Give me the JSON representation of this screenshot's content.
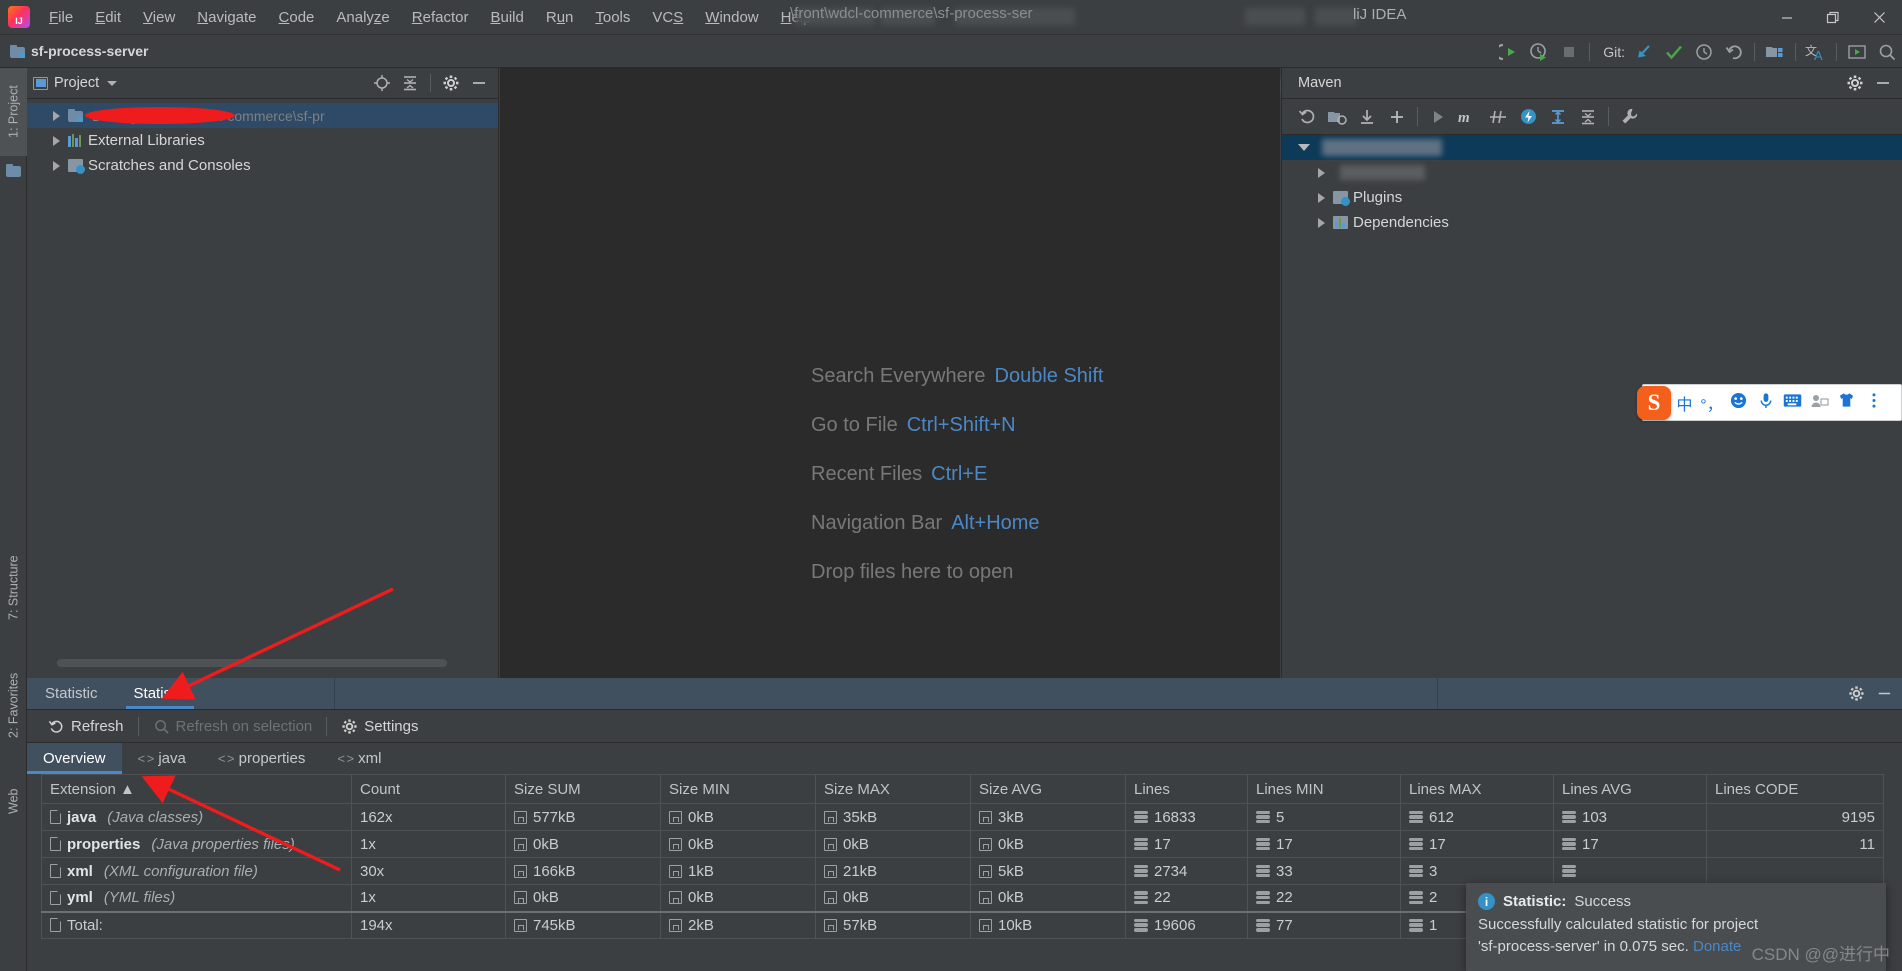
{
  "window": {
    "app_name": "liJ IDEA",
    "title_path_visible": "\\front\\wdcl-commerce\\sf-process-ser",
    "minimize": "─",
    "maximize": "❐",
    "close": "✕"
  },
  "menubar": {
    "items": [
      {
        "label": "File"
      },
      {
        "label": "Edit"
      },
      {
        "label": "View"
      },
      {
        "label": "Navigate"
      },
      {
        "label": "Code"
      },
      {
        "label": "Analyze"
      },
      {
        "label": "Refactor"
      },
      {
        "label": "Build"
      },
      {
        "label": "Run"
      },
      {
        "label": "Tools"
      },
      {
        "label": "VCS"
      },
      {
        "label": "Window"
      },
      {
        "label": "Help"
      }
    ]
  },
  "toolbar": {
    "project_name": "sf-process-server",
    "git_label": "Git:"
  },
  "stripe": {
    "left_top": "1: Project",
    "structure": "7: Structure",
    "favorites": "2: Favorites",
    "web": "Web"
  },
  "project_panel": {
    "title": "Project",
    "tree": [
      {
        "label": "",
        "path": "D:\\fenglian\\front\\wdcl-commerce\\sf-pr",
        "icon": "module-icon",
        "selected": true,
        "redacted": true
      },
      {
        "label": "External Libraries",
        "path": "",
        "icon": "libraries-icon",
        "selected": false,
        "redacted": false
      },
      {
        "label": "Scratches and Consoles",
        "path": "",
        "icon": "scratches-icon",
        "selected": false,
        "redacted": false
      }
    ]
  },
  "editor": {
    "hints": [
      {
        "action": "Search Everywhere",
        "shortcut": "Double Shift"
      },
      {
        "action": "Go to File",
        "shortcut": "Ctrl+Shift+N"
      },
      {
        "action": "Recent Files",
        "shortcut": "Ctrl+E"
      },
      {
        "action": "Navigation Bar",
        "shortcut": "Alt+Home"
      },
      {
        "action": "Drop files here to open",
        "shortcut": ""
      }
    ]
  },
  "maven_panel": {
    "title": "Maven",
    "tree": [
      {
        "label": "",
        "blurred": true,
        "level": 0,
        "expanded": true,
        "selected": true
      },
      {
        "label": "",
        "blurred": true,
        "level": 1,
        "expanded": false,
        "selected": false
      },
      {
        "label": "Plugins",
        "blurred": false,
        "level": 1,
        "expanded": false,
        "selected": false
      },
      {
        "label": "Dependencies",
        "blurred": false,
        "level": 1,
        "expanded": false,
        "selected": false
      }
    ]
  },
  "bottom_window": {
    "tabs": [
      {
        "label": "Statistic",
        "active": false
      },
      {
        "label": "Statistic",
        "active": true
      }
    ],
    "actions": [
      {
        "label": "Refresh",
        "icon": "refresh-icon",
        "disabled": false
      },
      {
        "label": "Refresh on selection",
        "icon": "search-icon",
        "disabled": true
      },
      {
        "label": "Settings",
        "icon": "gear-icon",
        "disabled": false
      }
    ],
    "sub_tabs": [
      {
        "label": "Overview",
        "icon": "",
        "active": true
      },
      {
        "label": "java",
        "icon": "angle-brackets",
        "active": false
      },
      {
        "label": "properties",
        "icon": "angle-brackets",
        "active": false
      },
      {
        "label": "xml",
        "icon": "angle-brackets",
        "active": false
      }
    ]
  },
  "stat_table": {
    "columns": [
      "Extension ▲",
      "Count",
      "Size SUM",
      "Size MIN",
      "Size MAX",
      "Size AVG",
      "Lines",
      "Lines MIN",
      "Lines MAX",
      "Lines AVG",
      "Lines CODE"
    ],
    "rows": [
      {
        "extension": "java",
        "description": "(Java classes)",
        "count": "162x",
        "size_sum": "577kB",
        "size_min": "0kB",
        "size_max": "35kB",
        "size_avg": "3kB",
        "lines": "16833",
        "lines_min": "5",
        "lines_max": "612",
        "lines_avg": "103",
        "lines_code": "9195"
      },
      {
        "extension": "properties",
        "description": "(Java properties files)",
        "count": "1x",
        "size_sum": "0kB",
        "size_min": "0kB",
        "size_max": "0kB",
        "size_avg": "0kB",
        "lines": "17",
        "lines_min": "17",
        "lines_max": "17",
        "lines_avg": "17",
        "lines_code": "11"
      },
      {
        "extension": "xml",
        "description": "(XML configuration file)",
        "count": "30x",
        "size_sum": "166kB",
        "size_min": "1kB",
        "size_max": "21kB",
        "size_avg": "5kB",
        "lines": "2734",
        "lines_min": "33",
        "lines_max": "3",
        "lines_avg": "",
        "lines_code": ""
      },
      {
        "extension": "yml",
        "description": "(YML files)",
        "count": "1x",
        "size_sum": "0kB",
        "size_min": "0kB",
        "size_max": "0kB",
        "size_avg": "0kB",
        "lines": "22",
        "lines_min": "22",
        "lines_max": "2",
        "lines_avg": "",
        "lines_code": ""
      }
    ],
    "total": {
      "extension": "Total:",
      "description": "",
      "count": "194x",
      "size_sum": "745kB",
      "size_min": "2kB",
      "size_max": "57kB",
      "size_avg": "10kB",
      "lines": "19606",
      "lines_min": "77",
      "lines_max": "1",
      "lines_avg": "",
      "lines_code": ""
    }
  },
  "notification": {
    "title_label": "Statistic:",
    "status": "Success",
    "message_line1": "Successfully calculated statistic for project",
    "message_line2": "'sf-process-server' in 0.075 sec.",
    "link": "Donate"
  },
  "watermark": "CSDN @@进行中",
  "ime": {
    "name": "sogou-input-bar",
    "logo": "S",
    "icons": [
      "中",
      "°，",
      "smiley-icon",
      "microphone-icon",
      "keyboard-icon",
      "user-icon",
      "shirt-icon",
      "menu-icon"
    ]
  },
  "colors": {
    "accent_blue": "#4a88c7",
    "selection": "#2f4a66",
    "maven_selection": "#0d3a58",
    "panel_bg": "#3c3f41",
    "editor_bg": "#2b2b2b",
    "annotation_red": "#ee1c1c"
  }
}
